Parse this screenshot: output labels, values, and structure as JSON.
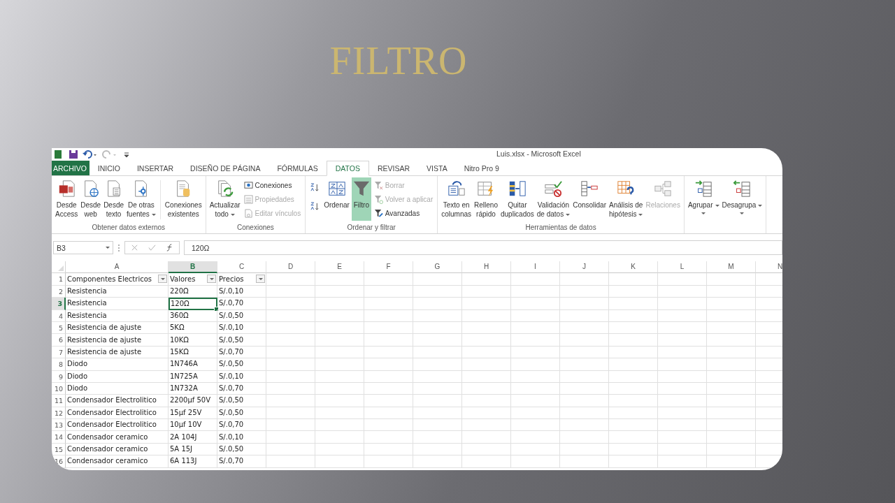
{
  "slide": {
    "title": "FILTRO"
  },
  "excel": {
    "window_title": "Luis.xlsx - Microsoft Excel",
    "tabs": [
      {
        "label": "ARCHIVO",
        "kind": "file",
        "selected": false
      },
      {
        "label": "INICIO",
        "kind": "tab",
        "selected": false
      },
      {
        "label": "INSERTAR",
        "kind": "tab",
        "selected": false
      },
      {
        "label": "DISEÑO DE PÁGINA",
        "kind": "tab",
        "selected": false
      },
      {
        "label": "FÓRMULAS",
        "kind": "tab",
        "selected": false
      },
      {
        "label": "DATOS",
        "kind": "tab",
        "selected": true
      },
      {
        "label": "REVISAR",
        "kind": "tab",
        "selected": false
      },
      {
        "label": "VISTA",
        "kind": "tab",
        "selected": false
      },
      {
        "label": "Nitro Pro 9",
        "kind": "tab",
        "selected": false
      }
    ],
    "ribbon": [
      {
        "label": "Obtener datos externos",
        "buttons": [
          {
            "kind": "large",
            "lines": [
              "Desde",
              "Access"
            ],
            "dropdown": false,
            "disabled": false,
            "active": false
          },
          {
            "kind": "large",
            "lines": [
              "Desde",
              "web"
            ],
            "dropdown": false,
            "disabled": false,
            "active": false
          },
          {
            "kind": "large",
            "lines": [
              "Desde",
              "texto"
            ],
            "dropdown": false,
            "disabled": false,
            "active": false
          },
          {
            "kind": "large",
            "lines": [
              "De otras",
              "fuentes"
            ],
            "dropdown": true,
            "disabled": false,
            "active": false
          },
          {
            "kind": "sep"
          },
          {
            "kind": "large",
            "lines": [
              "Conexiones",
              "existentes"
            ],
            "dropdown": false,
            "disabled": false,
            "active": false
          }
        ]
      },
      {
        "label": "Conexiones",
        "buttons": [
          {
            "kind": "large",
            "lines": [
              "Actualizar",
              "todo"
            ],
            "dropdown": true,
            "disabled": false,
            "active": false
          },
          {
            "kind": "stack",
            "items": [
              {
                "label": "Conexiones",
                "disabled": false
              },
              {
                "label": "Propiedades",
                "disabled": true
              },
              {
                "label": "Editar vínculos",
                "disabled": true
              }
            ]
          }
        ]
      },
      {
        "label": "Ordenar y filtrar",
        "buttons": [
          {
            "kind": "sortpair"
          },
          {
            "kind": "large",
            "lines": [
              "Ordenar"
            ],
            "dropdown": false,
            "disabled": false,
            "active": false
          },
          {
            "kind": "large",
            "lines": [
              "Filtro"
            ],
            "dropdown": false,
            "disabled": false,
            "active": true
          },
          {
            "kind": "stack",
            "items": [
              {
                "label": "Borrar",
                "disabled": true
              },
              {
                "label": "Volver a aplicar",
                "disabled": true
              },
              {
                "label": "Avanzadas",
                "disabled": false
              }
            ]
          }
        ]
      },
      {
        "label": "Herramientas de datos",
        "buttons": [
          {
            "kind": "large",
            "lines": [
              "Texto en",
              "columnas"
            ],
            "dropdown": false,
            "disabled": false,
            "active": false
          },
          {
            "kind": "large",
            "lines": [
              "Relleno",
              "rápido"
            ],
            "dropdown": false,
            "disabled": false,
            "active": false
          },
          {
            "kind": "large",
            "lines": [
              "Quitar",
              "duplicados"
            ],
            "dropdown": false,
            "disabled": false,
            "active": false
          },
          {
            "kind": "large",
            "lines": [
              "Validación",
              "de datos"
            ],
            "dropdown": true,
            "disabled": false,
            "active": false
          },
          {
            "kind": "large",
            "lines": [
              "Consolidar"
            ],
            "dropdown": false,
            "disabled": false,
            "active": false
          },
          {
            "kind": "large",
            "lines": [
              "Análisis de",
              "hipótesis"
            ],
            "dropdown": true,
            "disabled": false,
            "active": false
          },
          {
            "kind": "large",
            "lines": [
              "Relaciones"
            ],
            "dropdown": false,
            "disabled": true,
            "active": false
          }
        ]
      },
      {
        "buttons": [
          {
            "kind": "large",
            "lines": [
              "Agrupar"
            ],
            "dropdown": true,
            "disabled": false,
            "active": false
          },
          {
            "kind": "large",
            "lines": [
              "Desagrupa"
            ],
            "dropdown": true,
            "disabled": false,
            "active": false
          }
        ]
      }
    ],
    "name_box": "B3",
    "formula": "120Ω",
    "columns": [
      {
        "label": "A",
        "selected": false
      },
      {
        "label": "B",
        "selected": true
      },
      {
        "label": "C",
        "selected": false
      },
      {
        "label": "D",
        "selected": false
      },
      {
        "label": "E",
        "selected": false
      },
      {
        "label": "F",
        "selected": false
      },
      {
        "label": "G",
        "selected": false
      },
      {
        "label": "H",
        "selected": false
      },
      {
        "label": "I",
        "selected": false
      },
      {
        "label": "J",
        "selected": false
      },
      {
        "label": "K",
        "selected": false
      },
      {
        "label": "L",
        "selected": false
      },
      {
        "label": "M",
        "selected": false
      },
      {
        "label": "N",
        "selected": false
      }
    ],
    "rows": [
      {
        "number": "1",
        "kind": "header",
        "selected": false,
        "cells": [
          "Componentes Electricos",
          "Valores",
          "Precios"
        ]
      },
      {
        "number": "2",
        "kind": "data",
        "selected": false,
        "cells": [
          "Resistencia",
          "220Ω",
          "S/.0,10"
        ]
      },
      {
        "number": "3",
        "kind": "data",
        "selected": true,
        "cells": [
          "Resistencia",
          "120Ω",
          "S/.0,70"
        ]
      },
      {
        "number": "4",
        "kind": "data",
        "selected": false,
        "cells": [
          "Resistencia",
          "360Ω",
          "S/.0,50"
        ]
      },
      {
        "number": "5",
        "kind": "data",
        "selected": false,
        "cells": [
          "Resistencia de ajuste",
          "5KΩ",
          "S/.0,10"
        ]
      },
      {
        "number": "6",
        "kind": "data",
        "selected": false,
        "cells": [
          "Resistencia de ajuste",
          "10KΩ",
          "S/.0,50"
        ]
      },
      {
        "number": "7",
        "kind": "data",
        "selected": false,
        "cells": [
          "Resistencia de ajuste",
          "15KΩ",
          "S/.0,70"
        ]
      },
      {
        "number": "8",
        "kind": "data",
        "selected": false,
        "cells": [
          "Diodo",
          "1N746A",
          "S/.0,50"
        ]
      },
      {
        "number": "9",
        "kind": "data",
        "selected": false,
        "cells": [
          "Diodo",
          "1N725A",
          "S/.0,10"
        ]
      },
      {
        "number": "10",
        "kind": "data",
        "selected": false,
        "cells": [
          "Diodo",
          "1N732A",
          "S/.0,70"
        ]
      },
      {
        "number": "11",
        "kind": "data",
        "selected": false,
        "cells": [
          "Condensador Electrolitico",
          "2200µf 50V",
          "S/.0,50"
        ]
      },
      {
        "number": "12",
        "kind": "data",
        "selected": false,
        "cells": [
          "Condensador Electrolitico",
          "15µf 25V",
          "S/.0,50"
        ]
      },
      {
        "number": "13",
        "kind": "data",
        "selected": false,
        "cells": [
          "Condensador Electrolitico",
          "10µf 10V",
          "S/.0,70"
        ]
      },
      {
        "number": "14",
        "kind": "data",
        "selected": false,
        "cells": [
          "Condensador ceramico",
          "2A 104J",
          "S/.0,10"
        ]
      },
      {
        "number": "15",
        "kind": "data",
        "selected": false,
        "cells": [
          "Condensador ceramico",
          "5A 15J",
          "S/.0,50"
        ]
      },
      {
        "number": "16",
        "kind": "data",
        "selected": false,
        "cells": [
          "Condensador ceramico",
          "6A 113J",
          "S/.0,70"
        ]
      }
    ]
  }
}
